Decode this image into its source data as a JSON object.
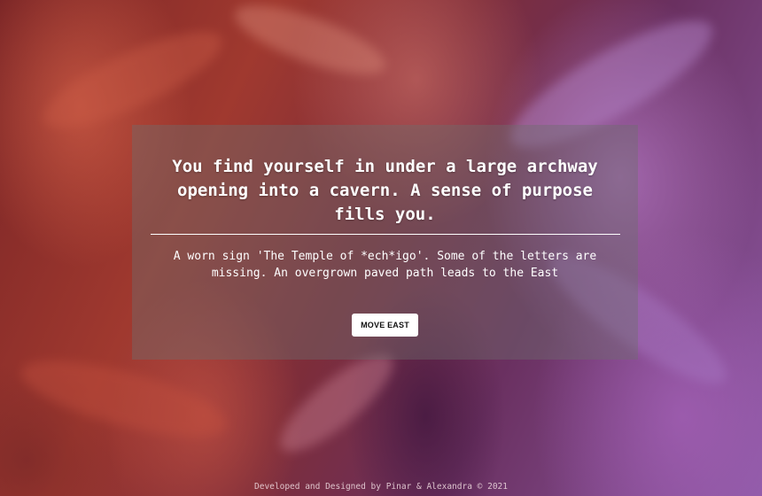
{
  "scene": {
    "title": "You find yourself in under a large archway opening into a cavern. A sense of purpose fills you.",
    "description": "A worn sign 'The Temple of *ech*igo'. Some of the letters are missing. An overgrown paved path leads to the East"
  },
  "actions": {
    "move_east_label": "MOVE EAST"
  },
  "footer": {
    "credits": "Developed and Designed by Pinar & Alexandra © 2021"
  },
  "colors": {
    "panel_overlay": "#6e6e6e",
    "button_bg": "#ffffff",
    "button_text": "#111111",
    "text": "#ffffff"
  }
}
